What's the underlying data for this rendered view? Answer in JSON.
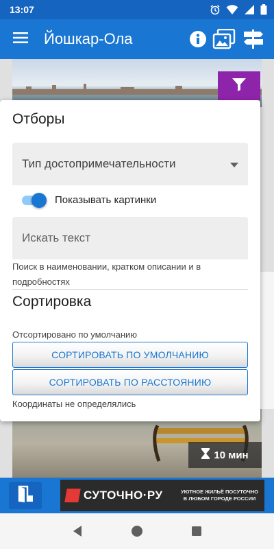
{
  "status_bar": {
    "time": "13:07"
  },
  "app_bar": {
    "title": "Йошкар-Ола"
  },
  "filters": {
    "heading": "Отборы",
    "type_select_value": "Тип достопримечательности",
    "show_images_label": "Показывать картинки",
    "show_images_on": true,
    "search_placeholder": "Искать текст",
    "search_hint": "Поиск в наименовании, кратком описании и в подробностях"
  },
  "sorting": {
    "heading": "Сортировка",
    "status": "Отсортировано по умолчанию",
    "sort_default_label": "Сортировать по умолчанию",
    "sort_distance_label": "Сортировать по расстоянию",
    "coords_note": "Координаты не определялись"
  },
  "card": {
    "duration": "10 мин"
  },
  "ad": {
    "brand": "СУТОЧНО·РУ",
    "slogan": "УЮТНОЕ ЖИЛЬЁ ПОСУТОЧНО В ЛЮБОМ ГОРОДЕ РОССИИ"
  },
  "colors": {
    "status_bar": "#1565c0",
    "app_bar": "#1976d2",
    "filter_fab": "#8e24aa",
    "accent": "#1976d2"
  },
  "icons": {
    "menu": "hamburger-icon",
    "info": "info-icon",
    "gallery": "image-gallery-icon",
    "signpost": "signpost-icon",
    "filter": "funnel-icon",
    "hourglass": "hourglass-icon",
    "exit": "exit-door-icon"
  }
}
